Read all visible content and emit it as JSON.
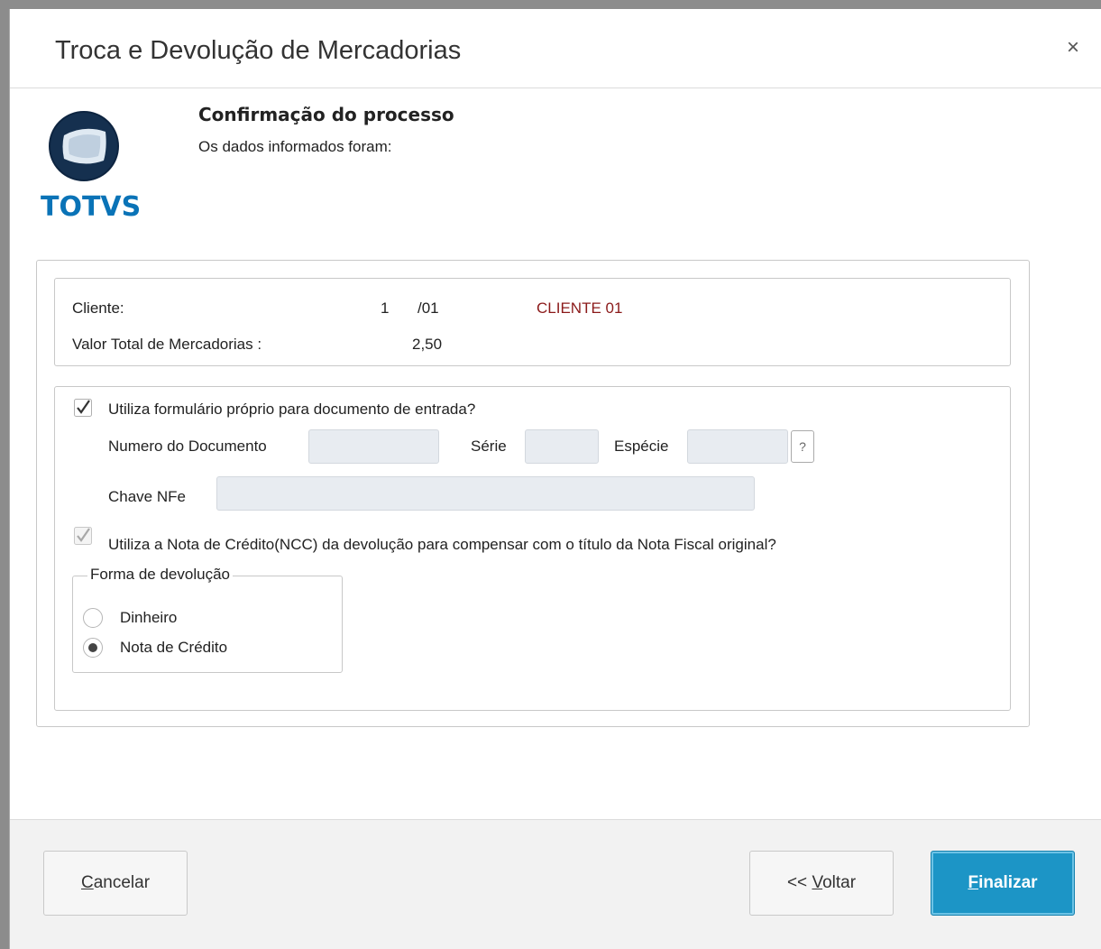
{
  "window": {
    "title": "Troca e Devolução de Mercadorias",
    "close_glyph": "×"
  },
  "logo": {
    "text": "TOTVS",
    "color": "#0a73b7"
  },
  "header": {
    "title": "Confirmação do processo",
    "subtitle": "Os dados informados foram:"
  },
  "client": {
    "label": "Cliente:",
    "code": "1",
    "store": "/01",
    "name": "CLIENTE 01",
    "total_label": "Valor Total de Mercadorias :",
    "total_value": "2,50"
  },
  "form": {
    "own_form_checkbox": {
      "label": "Utiliza formulário próprio para documento de entrada?",
      "checked": true
    },
    "doc_number_label": "Numero do Documento",
    "doc_number_value": "",
    "serie_label": "Série",
    "serie_value": "",
    "especie_label": "Espécie",
    "especie_value": "",
    "help_label": "?",
    "chave_label": "Chave NFe",
    "chave_value": "",
    "ncc_checkbox": {
      "label": "Utiliza a Nota de Crédito(NCC) da devolução para compensar com o título da Nota Fiscal original?",
      "checked": true,
      "disabled": true
    }
  },
  "refund": {
    "legend": "Forma de devolução",
    "options": [
      {
        "label": "Dinheiro",
        "selected": false
      },
      {
        "label": "Nota de Crédito",
        "selected": true
      }
    ]
  },
  "footer": {
    "cancel": {
      "mnemonic": "C",
      "rest": "ancelar"
    },
    "back": {
      "prefix": "<< ",
      "mnemonic": "V",
      "rest": "oltar"
    },
    "finish": {
      "mnemonic": "F",
      "rest": "inalizar"
    }
  },
  "colors": {
    "primary": "#1c95c6",
    "client_name": "#8b1a1a"
  }
}
